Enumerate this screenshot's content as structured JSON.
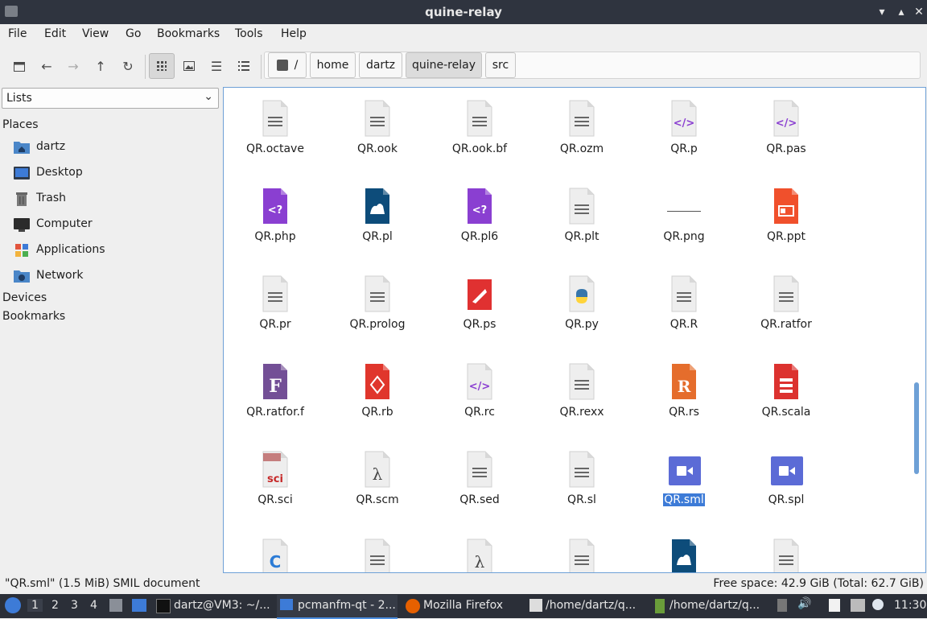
{
  "window": {
    "title": "quine-relay"
  },
  "menu": [
    "File",
    "Edit",
    "View",
    "Go",
    "Bookmarks",
    "Tools",
    "Help"
  ],
  "breadcrumbs": [
    "/",
    "home",
    "dartz",
    "quine-relay",
    "src"
  ],
  "sidebar": {
    "combo_value": "Lists",
    "places_header": "Places",
    "places": [
      {
        "label": "dartz",
        "icon": "home-folder-icon"
      },
      {
        "label": "Desktop",
        "icon": "desktop-icon"
      },
      {
        "label": "Trash",
        "icon": "trash-icon"
      },
      {
        "label": "Computer",
        "icon": "computer-icon"
      },
      {
        "label": "Applications",
        "icon": "applications-icon"
      },
      {
        "label": "Network",
        "icon": "network-icon"
      }
    ],
    "devices_header": "Devices",
    "bookmarks_header": "Bookmarks"
  },
  "files": [
    {
      "name": "QR.octave",
      "icon": "text"
    },
    {
      "name": "QR.ook",
      "icon": "text"
    },
    {
      "name": "QR.ook.bf",
      "icon": "text"
    },
    {
      "name": "QR.ozm",
      "icon": "text"
    },
    {
      "name": "QR.p",
      "icon": "code"
    },
    {
      "name": "QR.pas",
      "icon": "code"
    },
    {
      "name": "QR.php",
      "icon": "php"
    },
    {
      "name": "QR.pl",
      "icon": "camel"
    },
    {
      "name": "QR.pl6",
      "icon": "php"
    },
    {
      "name": "QR.plt",
      "icon": "text"
    },
    {
      "name": "QR.png",
      "icon": "image-line"
    },
    {
      "name": "QR.ppt",
      "icon": "presentation"
    },
    {
      "name": "QR.pr",
      "icon": "text"
    },
    {
      "name": "QR.prolog",
      "icon": "text"
    },
    {
      "name": "QR.ps",
      "icon": "postscript"
    },
    {
      "name": "QR.py",
      "icon": "python"
    },
    {
      "name": "QR.R",
      "icon": "text"
    },
    {
      "name": "QR.ratfor",
      "icon": "text"
    },
    {
      "name": "QR.ratfor.f",
      "icon": "fortran"
    },
    {
      "name": "QR.rb",
      "icon": "ruby"
    },
    {
      "name": "QR.rc",
      "icon": "code"
    },
    {
      "name": "QR.rexx",
      "icon": "text"
    },
    {
      "name": "QR.rs",
      "icon": "rust"
    },
    {
      "name": "QR.scala",
      "icon": "scala"
    },
    {
      "name": "QR.sci",
      "icon": "scilab"
    },
    {
      "name": "QR.scm",
      "icon": "lambda"
    },
    {
      "name": "QR.sed",
      "icon": "text"
    },
    {
      "name": "QR.sl",
      "icon": "text"
    },
    {
      "name": "QR.sml",
      "icon": "video",
      "selected": true
    },
    {
      "name": "QR.spl",
      "icon": "video"
    },
    {
      "name": "",
      "icon": "c-lang"
    },
    {
      "name": "",
      "icon": "text"
    },
    {
      "name": "",
      "icon": "lambda"
    },
    {
      "name": "",
      "icon": "text"
    },
    {
      "name": "",
      "icon": "camel"
    },
    {
      "name": "",
      "icon": "text"
    }
  ],
  "status": {
    "left": "\"QR.sml\" (1.5 MiB) SMIL document",
    "right": "Free space: 42.9 GiB (Total: 62.7 GiB)"
  },
  "taskbar": {
    "workspaces": [
      "1",
      "2",
      "3",
      "4"
    ],
    "tasks": [
      "dartz@VM3: ~/...",
      "pcmanfm-qt - 2...",
      "Mozilla Firefox",
      "/home/dartz/q...",
      "/home/dartz/q..."
    ],
    "clock": "11:30"
  },
  "colors": {
    "selection": "#3d7bd7",
    "accent": "#6ea0d6",
    "titlebar": "#2f343f"
  }
}
